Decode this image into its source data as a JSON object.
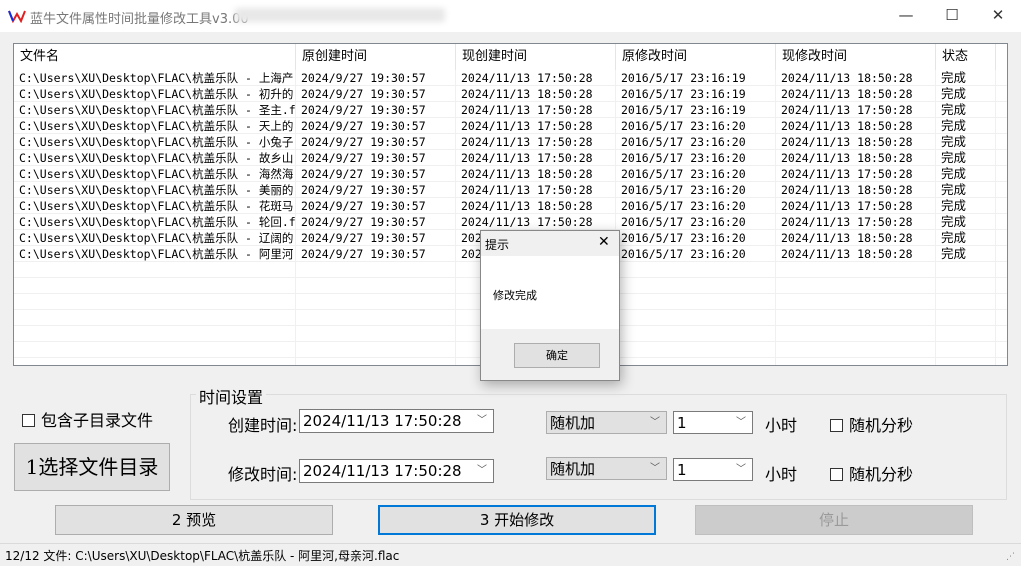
{
  "window": {
    "title": "蓝牛文件属性时间批量修改工具v3.00",
    "minimize": "—",
    "maximize": "☐",
    "close": "✕"
  },
  "table": {
    "columns": [
      "文件名",
      "原创建时间",
      "现创建时间",
      "原修改时间",
      "现修改时间",
      "状态"
    ],
    "rows": [
      [
        "C:\\Users\\XU\\Desktop\\FLAC\\杭盖乐队 - 上海产...",
        "2024/9/27 19:30:57",
        "2024/11/13 17:50:28",
        "2016/5/17 23:16:19",
        "2024/11/13 18:50:28",
        "完成"
      ],
      [
        "C:\\Users\\XU\\Desktop\\FLAC\\杭盖乐队 - 初升的...",
        "2024/9/27 19:30:57",
        "2024/11/13 18:50:28",
        "2016/5/17 23:16:19",
        "2024/11/13 18:50:28",
        "完成"
      ],
      [
        "C:\\Users\\XU\\Desktop\\FLAC\\杭盖乐队 - 圣主.flac",
        "2024/9/27 19:30:57",
        "2024/11/13 17:50:28",
        "2016/5/17 23:16:19",
        "2024/11/13 17:50:28",
        "完成"
      ],
      [
        "C:\\Users\\XU\\Desktop\\FLAC\\杭盖乐队 - 天上的...",
        "2024/9/27 19:30:57",
        "2024/11/13 17:50:28",
        "2016/5/17 23:16:20",
        "2024/11/13 18:50:28",
        "完成"
      ],
      [
        "C:\\Users\\XU\\Desktop\\FLAC\\杭盖乐队 - 小兔子...",
        "2024/9/27 19:30:57",
        "2024/11/13 17:50:28",
        "2016/5/17 23:16:20",
        "2024/11/13 18:50:28",
        "完成"
      ],
      [
        "C:\\Users\\XU\\Desktop\\FLAC\\杭盖乐队 - 故乡山...",
        "2024/9/27 19:30:57",
        "2024/11/13 17:50:28",
        "2016/5/17 23:16:20",
        "2024/11/13 18:50:28",
        "完成"
      ],
      [
        "C:\\Users\\XU\\Desktop\\FLAC\\杭盖乐队 - 海然海...",
        "2024/9/27 19:30:57",
        "2024/11/13 18:50:28",
        "2016/5/17 23:16:20",
        "2024/11/13 17:50:28",
        "完成"
      ],
      [
        "C:\\Users\\XU\\Desktop\\FLAC\\杭盖乐队 - 美丽的...",
        "2024/9/27 19:30:57",
        "2024/11/13 17:50:28",
        "2016/5/17 23:16:20",
        "2024/11/13 18:50:28",
        "完成"
      ],
      [
        "C:\\Users\\XU\\Desktop\\FLAC\\杭盖乐队 - 花斑马...",
        "2024/9/27 19:30:57",
        "2024/11/13 18:50:28",
        "2016/5/17 23:16:20",
        "2024/11/13 17:50:28",
        "完成"
      ],
      [
        "C:\\Users\\XU\\Desktop\\FLAC\\杭盖乐队 - 轮回.flac",
        "2024/9/27 19:30:57",
        "2024/11/13 17:50:28",
        "2016/5/17 23:16:20",
        "2024/11/13 17:50:28",
        "完成"
      ],
      [
        "C:\\Users\\XU\\Desktop\\FLAC\\杭盖乐队 - 辽阔的...",
        "2024/9/27 19:30:57",
        "2024",
        "2016/5/17 23:16:20",
        "2024/11/13 18:50:28",
        "完成"
      ],
      [
        "C:\\Users\\XU\\Desktop\\FLAC\\杭盖乐队 - 阿里河...",
        "2024/9/27 19:30:57",
        "2024",
        "2016/5/17 23:16:20",
        "2024/11/13 18:50:28",
        "完成"
      ]
    ]
  },
  "dialog": {
    "title": "提示",
    "message": "修改完成",
    "ok": "确定",
    "close": "✕"
  },
  "options": {
    "include_subdirs": "包含子目录文件",
    "select_dir": "1选择文件目录"
  },
  "time_settings": {
    "group_label": "时间设置",
    "create": {
      "label": "创建时间:",
      "value": "2024/11/13 17:50:28",
      "mode": "随机加",
      "amount": "1",
      "unit": "小时",
      "random_label": "随机分秒"
    },
    "modify": {
      "label": "修改时间:",
      "value": "2024/11/13 17:50:28",
      "mode": "随机加",
      "amount": "1",
      "unit": "小时",
      "random_label": "随机分秒"
    }
  },
  "actions": {
    "preview": "2 预览",
    "start": "3 开始修改",
    "stop": "停止"
  },
  "status": "12/12 文件: C:\\Users\\XU\\Desktop\\FLAC\\杭盖乐队 - 阿里河,母亲河.flac",
  "colors": {
    "accent": "#0078d7",
    "logo_red": "#e02020",
    "logo_blue": "#1030e0"
  }
}
